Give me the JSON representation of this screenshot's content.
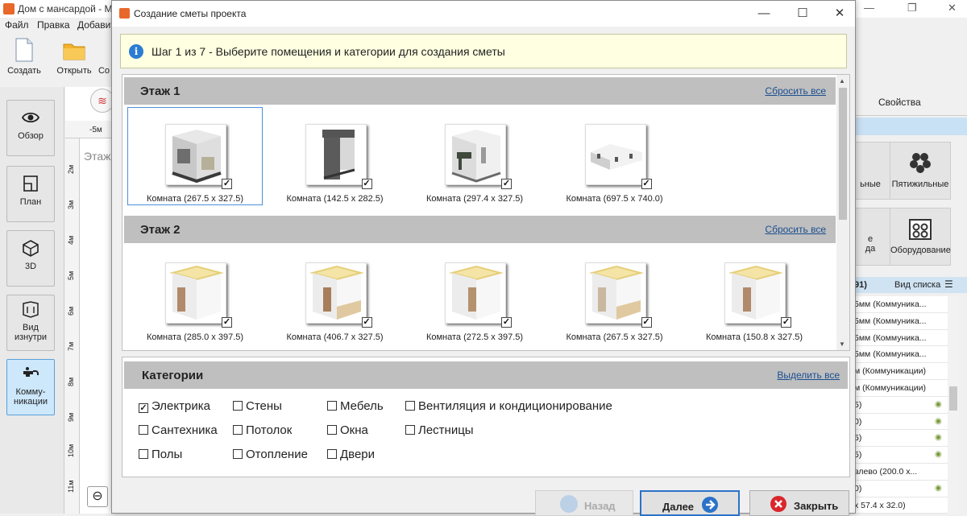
{
  "app": {
    "title": "Дом с мансардой - Мо",
    "menu": [
      "Файл",
      "Правка",
      "Добавит"
    ],
    "toolbar": [
      "Создать",
      "Открыть",
      "Со"
    ],
    "side_nav": [
      "Обзор",
      "План",
      "3D",
      "Вид изнутри",
      "Комму-\nникации"
    ],
    "ruler_top": "-5м",
    "ruler_left": [
      "2м",
      "3м",
      "4м",
      "5м",
      "6м",
      "7м",
      "8м",
      "9м",
      "10м",
      "11м"
    ],
    "canvas_floor": "Этаж",
    "right_tab": "Свойства",
    "tiles": [
      "ьные",
      "Пятижильные",
      "е\nда",
      "Оборудование"
    ],
    "list_count": "91)",
    "list_view": "Вид списка",
    "list_items": [
      "5мм (Коммуника...",
      "5мм (Коммуника...",
      "5мм (Коммуника...",
      "5мм (Коммуника...",
      "м (Коммуникации)",
      "м (Коммуникации)",
      "5)",
      "0)",
      "5)",
      "5)",
      "влево (200.0 x...",
      "0)",
      "х 57.4 х 32.0)"
    ]
  },
  "dialog": {
    "title": "Создание сметы проекта",
    "step_text": "Шаг 1 из 7 - Выберите помещения и категории для создания сметы",
    "reset_label": "Сбросить все",
    "floors": [
      {
        "name": "Этаж 1",
        "rooms": [
          {
            "label": "Комната (267.5 x 327.5)",
            "checked": true,
            "selected": true
          },
          {
            "label": "Комната (142.5 x 282.5)",
            "checked": true,
            "selected": false
          },
          {
            "label": "Комната (297.4 x 327.5)",
            "checked": true,
            "selected": false
          },
          {
            "label": "Комната (697.5 x 740.0)",
            "checked": true,
            "selected": false
          }
        ]
      },
      {
        "name": "Этаж 2",
        "rooms": [
          {
            "label": "Комната (285.0 x 397.5)",
            "checked": true,
            "selected": false
          },
          {
            "label": "Комната (406.7 x 327.5)",
            "checked": true,
            "selected": false
          },
          {
            "label": "Комната (272.5 x 397.5)",
            "checked": true,
            "selected": false
          },
          {
            "label": "Комната (267.5 x 327.5)",
            "checked": true,
            "selected": false
          },
          {
            "label": "Комната (150.8 x 327.5)",
            "checked": true,
            "selected": false
          }
        ]
      }
    ],
    "categories_title": "Категории",
    "select_all": "Выделить все",
    "categories": [
      {
        "label": "Электрика",
        "checked": true
      },
      {
        "label": "Стены",
        "checked": false
      },
      {
        "label": "Мебель",
        "checked": false
      },
      {
        "label": "Вентиляция и кондиционирование",
        "checked": false
      },
      {
        "label": "Сантехника",
        "checked": false
      },
      {
        "label": "Потолок",
        "checked": false
      },
      {
        "label": "Окна",
        "checked": false
      },
      {
        "label": "Лестницы",
        "checked": false
      },
      {
        "label": "Полы",
        "checked": false
      },
      {
        "label": "Отопление",
        "checked": false
      },
      {
        "label": "Двери",
        "checked": false
      }
    ],
    "buttons": {
      "back": "Назад",
      "next": "Далее",
      "close": "Закрыть"
    }
  },
  "colors": {
    "accent": "#2b72c8",
    "info_bg": "#ffffe1",
    "header_gray": "#bfbfbf",
    "link": "#1a4e8f",
    "close_red": "#d9262c"
  }
}
